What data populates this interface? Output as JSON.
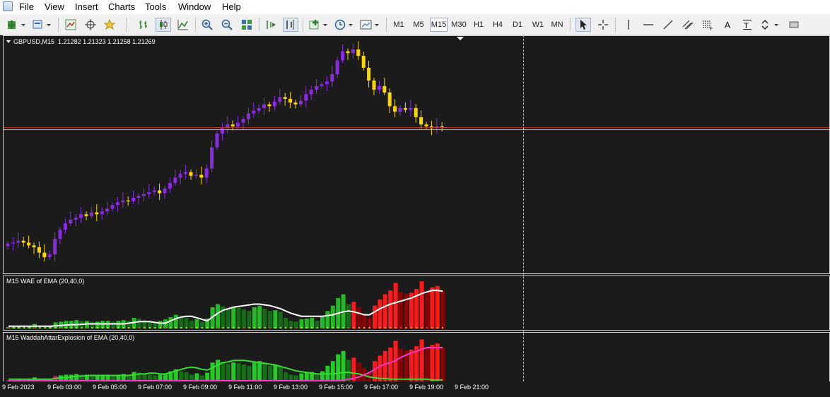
{
  "menu": {
    "items": [
      "File",
      "View",
      "Insert",
      "Charts",
      "Tools",
      "Window",
      "Help"
    ]
  },
  "toolbar": {
    "timeframes": [
      "M1",
      "M5",
      "M15",
      "M30",
      "H1",
      "H4",
      "D1",
      "W1",
      "MN"
    ],
    "active_timeframe": "M15",
    "text_tool": "A"
  },
  "main_chart": {
    "symbol_label": "GBPUSD,M15",
    "ohlc_label": "1.21282 1.21323 1.21258 1.21269",
    "bull_color": "#8a2be2",
    "bear_color": "#ffd700",
    "price_line_color": "#c0392b"
  },
  "indicator1": {
    "label": "M15 WAE of EMA (20,40,0)"
  },
  "indicator2": {
    "label": "M15 WaddahAttarExplosion of EMA (20,40,0)"
  },
  "time_axis": {
    "labels": [
      "9 Feb 2023",
      "9 Feb 03:00",
      "9 Feb 05:00",
      "9 Feb 07:00",
      "9 Feb 09:00",
      "9 Feb 11:00",
      "9 Feb 13:00",
      "9 Feb 15:00",
      "9 Feb 17:00",
      "9 Feb 19:00",
      "9 Feb 21:00"
    ]
  },
  "chart_data": {
    "type": "candlestick",
    "bars_per_hour": 4,
    "candles_close_approx": [
      1.204,
      1.2041,
      1.2043,
      1.2041,
      1.2038,
      1.2036,
      1.203,
      1.2025,
      1.2028,
      1.2045,
      1.2055,
      1.2062,
      1.2066,
      1.2068,
      1.2072,
      1.207,
      1.2074,
      1.2072,
      1.2075,
      1.2078,
      1.2082,
      1.2085,
      1.2087,
      1.2086,
      1.209,
      1.2092,
      1.2094,
      1.2096,
      1.2098,
      1.2095,
      1.21,
      1.2106,
      1.2112,
      1.2116,
      1.2118,
      1.2114,
      1.2115,
      1.2112,
      1.2122,
      1.2145,
      1.216,
      1.2166,
      1.217,
      1.2168,
      1.2172,
      1.2176,
      1.2182,
      1.2185,
      1.2188,
      1.2192,
      1.219,
      1.2195,
      1.22,
      1.2198,
      1.2194,
      1.2192,
      1.2196,
      1.2203,
      1.2208,
      1.2212,
      1.2214,
      1.2217,
      1.2225,
      1.224,
      1.225,
      1.2248,
      1.2252,
      1.2245,
      1.2232,
      1.2218,
      1.2208,
      1.2212,
      1.2205,
      1.219,
      1.2184,
      1.2188,
      1.2186,
      1.2188,
      1.2178,
      1.217,
      1.2168,
      1.2166,
      1.2168,
      1.2167
    ],
    "wae": {
      "trend_bars_approx": [
        0.2,
        0.2,
        0.25,
        0.2,
        0.3,
        0.6,
        0.4,
        0.3,
        0.3,
        0.8,
        0.9,
        1.0,
        1.0,
        1.1,
        1.0,
        1.0,
        0.9,
        0.9,
        1.0,
        1.0,
        0.9,
        1.0,
        1.1,
        1.0,
        1.4,
        1.3,
        1.1,
        1.0,
        0.9,
        1.0,
        1.2,
        1.5,
        1.8,
        1.5,
        1.4,
        1.0,
        1.2,
        0.9,
        1.3,
        2.8,
        3.2,
        2.9,
        2.6,
        2.8,
        2.7,
        2.5,
        2.3,
        2.8,
        3.0,
        2.6,
        2.3,
        2.4,
        2.2,
        1.4,
        1.0,
        0.9,
        1.2,
        1.3,
        1.4,
        1.0,
        1.5,
        2.3,
        3.0,
        4.0,
        4.5,
        3.2,
        3.5,
        2.8,
        2.0,
        1.4,
        3.0,
        3.8,
        4.5,
        5.0,
        6.0,
        4.8,
        4.6,
        4.7,
        5.2,
        6.2,
        5.0,
        5.4,
        5.6,
        5.0
      ],
      "explosion_line_approx": [
        0.3,
        0.3,
        0.3,
        0.3,
        0.3,
        0.3,
        0.3,
        0.3,
        0.3,
        0.35,
        0.4,
        0.45,
        0.5,
        0.5,
        0.55,
        0.6,
        0.6,
        0.6,
        0.6,
        0.6,
        0.6,
        0.6,
        0.6,
        0.7,
        0.8,
        0.9,
        0.9,
        0.9,
        0.8,
        0.7,
        0.7,
        1.0,
        1.3,
        1.5,
        1.6,
        1.6,
        1.4,
        1.2,
        1.0,
        1.5,
        2.0,
        2.4,
        2.6,
        2.8,
        2.9,
        3.0,
        3.1,
        3.2,
        3.2,
        3.1,
        3.0,
        2.8,
        2.6,
        2.3,
        2.0,
        1.8,
        1.6,
        1.6,
        1.6,
        1.6,
        1.6,
        1.7,
        1.8,
        2.0,
        2.2,
        2.3,
        2.2,
        2.0,
        1.8,
        1.8,
        2.2,
        2.6,
        2.9,
        3.2,
        3.4,
        3.6,
        3.8,
        4.0,
        4.3,
        4.6,
        4.8,
        5.0,
        5.0,
        4.9
      ]
    },
    "waddah": {
      "explosion_line_approx": [
        0.3,
        0.3,
        0.3,
        0.3,
        0.3,
        0.3,
        0.3,
        0.3,
        0.3,
        0.4,
        0.5,
        0.5,
        0.6,
        0.7,
        0.7,
        0.8,
        0.8,
        0.8,
        0.8,
        0.8,
        0.8,
        0.8,
        0.8,
        0.8,
        0.9,
        1.0,
        1.0,
        1.1,
        1.1,
        1.0,
        1.0,
        1.2,
        1.4,
        1.6,
        1.8,
        1.9,
        1.8,
        1.6,
        1.5,
        1.8,
        2.2,
        2.5,
        2.6,
        2.8,
        2.8,
        2.8,
        2.7,
        2.6,
        2.5,
        2.4,
        2.3,
        2.2,
        2.0,
        1.8,
        1.6,
        1.4,
        1.3,
        1.2,
        1.1,
        1.0,
        1.0,
        1.0,
        1.0,
        1.1,
        1.2,
        1.2,
        1.1,
        1.0,
        0.8,
        0.6,
        0.5,
        0.4,
        0.4,
        0.3,
        0.3,
        0.3,
        0.3,
        0.3,
        0.3,
        0.3,
        0.3,
        0.2,
        0.2,
        0.2
      ],
      "deadzone_line_approx": [
        0.1,
        0.1,
        0.1,
        0.1,
        0.1,
        0.1,
        0.1,
        0.1,
        0.1,
        0.1,
        0.1,
        0.1,
        0.1,
        0.1,
        0.1,
        0.1,
        0.1,
        0.1,
        0.1,
        0.1,
        0.1,
        0.1,
        0.1,
        0.1,
        0.1,
        0.1,
        0.1,
        0.1,
        0.1,
        0.1,
        0.1,
        0.1,
        0.1,
        0.1,
        0.1,
        0.1,
        0.1,
        0.1,
        0.1,
        0.1,
        0.1,
        0.1,
        0.1,
        0.1,
        0.1,
        0.1,
        0.1,
        0.1,
        0.1,
        0.1,
        0.1,
        0.1,
        0.1,
        0.1,
        0.1,
        0.1,
        0.1,
        0.1,
        0.1,
        0.1,
        0.1,
        0.1,
        0.1,
        0.1,
        0.2,
        0.3,
        0.4,
        0.6,
        0.9,
        1.2,
        1.6,
        2.0,
        2.3,
        2.5,
        2.8,
        3.2,
        3.5,
        3.8,
        4.0,
        4.3,
        4.5,
        4.5,
        4.5,
        4.5
      ]
    }
  }
}
